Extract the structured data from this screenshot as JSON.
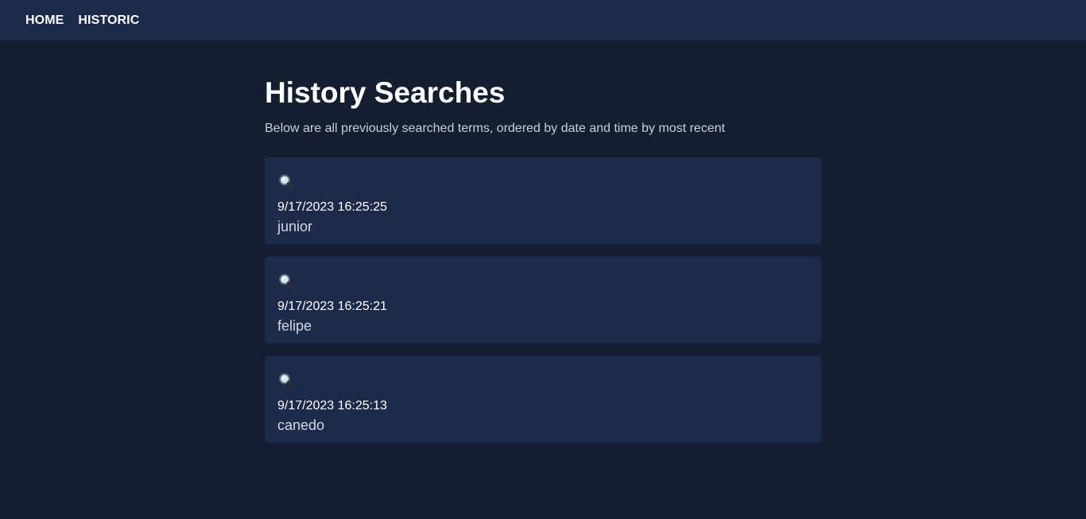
{
  "nav": {
    "items": [
      {
        "label": "HOME"
      },
      {
        "label": "HISTORIC"
      }
    ]
  },
  "main": {
    "title": "History Searches",
    "subtitle": "Below are all previously searched terms, ordered by date and time by most recent"
  },
  "history": [
    {
      "icon": "search-icon",
      "date": "9/17/2023 16:25:25",
      "term": "junior"
    },
    {
      "icon": "search-icon",
      "date": "9/17/2023 16:25:21",
      "term": "felipe"
    },
    {
      "icon": "search-icon",
      "date": "9/17/2023 16:25:13",
      "term": "canedo"
    }
  ],
  "colors": {
    "background": "#151e30",
    "surface": "#1e2a4a",
    "text": "#ffffff",
    "muted_text": "#c9ced8"
  }
}
